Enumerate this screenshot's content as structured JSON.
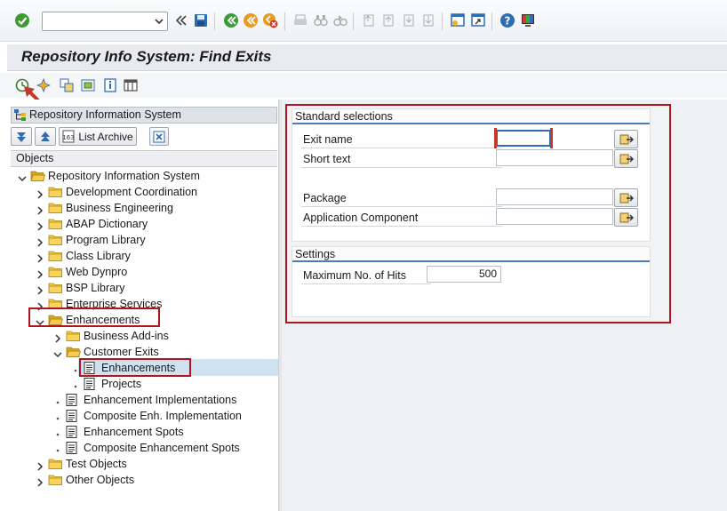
{
  "command_field": {
    "value": ""
  },
  "title": "Repository Info System: Find Exits",
  "left_pane": {
    "header": "Repository Information System",
    "list_archive_label": "List Archive",
    "objects_label": "Objects",
    "tree": [
      {
        "label": "Repository Information System",
        "level": 0,
        "state": "expanded"
      },
      {
        "label": "Development Coordination",
        "level": 1,
        "state": "collapsed"
      },
      {
        "label": "Business Engineering",
        "level": 1,
        "state": "collapsed"
      },
      {
        "label": "ABAP Dictionary",
        "level": 1,
        "state": "collapsed"
      },
      {
        "label": "Program Library",
        "level": 1,
        "state": "collapsed"
      },
      {
        "label": "Class Library",
        "level": 1,
        "state": "collapsed"
      },
      {
        "label": "Web Dynpro",
        "level": 1,
        "state": "collapsed"
      },
      {
        "label": "BSP Library",
        "level": 1,
        "state": "collapsed"
      },
      {
        "label": "Enterprise Services",
        "level": 1,
        "state": "collapsed"
      },
      {
        "label": "Enhancements",
        "level": 1,
        "state": "expanded"
      },
      {
        "label": "Business Add-ins",
        "level": 2,
        "state": "collapsed"
      },
      {
        "label": "Customer Exits",
        "level": 2,
        "state": "expanded"
      },
      {
        "label": "Enhancements",
        "level": 3,
        "state": "leaf",
        "selected": true
      },
      {
        "label": "Projects",
        "level": 3,
        "state": "leaf"
      },
      {
        "label": "Enhancement Implementations",
        "level": 2,
        "state": "leaf"
      },
      {
        "label": "Composite Enh. Implementation",
        "level": 2,
        "state": "leaf"
      },
      {
        "label": "Enhancement Spots",
        "level": 2,
        "state": "leaf"
      },
      {
        "label": "Composite Enhancement Spots",
        "level": 2,
        "state": "leaf"
      },
      {
        "label": "Test Objects",
        "level": 1,
        "state": "collapsed"
      },
      {
        "label": "Other Objects",
        "level": 1,
        "state": "collapsed"
      }
    ]
  },
  "standard_selections": {
    "title": "Standard selections",
    "exit_name_label": "Exit name",
    "exit_name_value": "",
    "short_text_label": "Short text",
    "short_text_value": "",
    "package_label": "Package",
    "package_value": "",
    "app_component_label": "Application Component",
    "app_component_value": ""
  },
  "settings": {
    "title": "Settings",
    "max_hits_label": "Maximum No. of Hits",
    "max_hits_value": "500"
  },
  "colors": {
    "highlight_red": "#b0141c",
    "selection_blue": "#cfe2f0",
    "group_underline": "#4a7fb5"
  }
}
